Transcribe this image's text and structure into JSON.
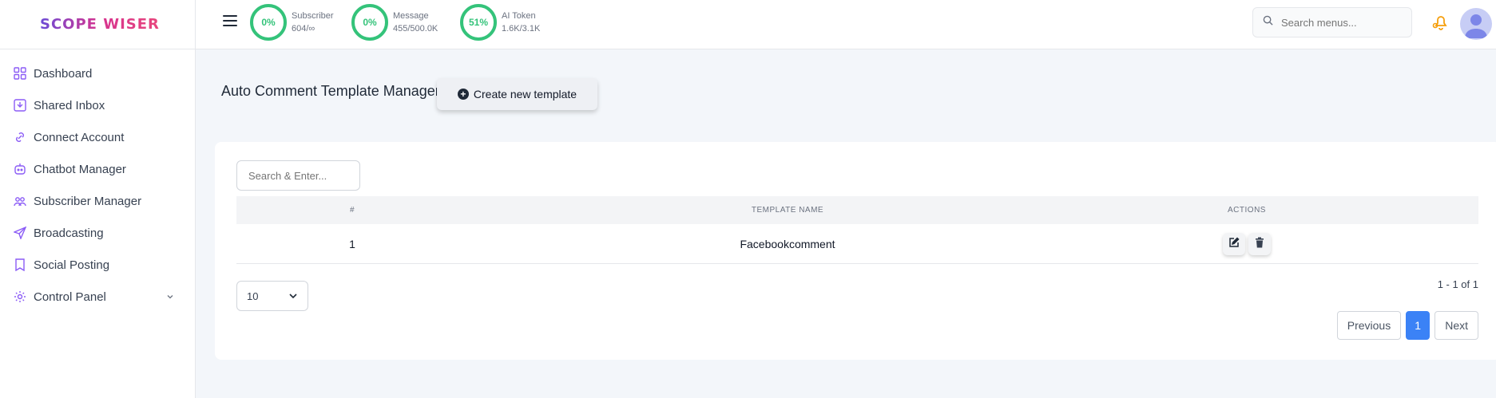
{
  "brand": {
    "logo_text": "SCOPE WISER"
  },
  "sidebar": {
    "items": [
      {
        "label": "Dashboard",
        "icon": "grid-icon"
      },
      {
        "label": "Shared Inbox",
        "icon": "inbox-icon"
      },
      {
        "label": "Connect Account",
        "icon": "link-icon"
      },
      {
        "label": "Chatbot Manager",
        "icon": "bot-icon"
      },
      {
        "label": "Subscriber Manager",
        "icon": "users-icon"
      },
      {
        "label": "Broadcasting",
        "icon": "send-icon"
      },
      {
        "label": "Social Posting",
        "icon": "bookmark-icon"
      },
      {
        "label": "Control Panel",
        "icon": "gear-icon"
      }
    ]
  },
  "stats": [
    {
      "percent": "0%",
      "label": "Subscriber",
      "value": "604/∞"
    },
    {
      "percent": "0%",
      "label": "Message",
      "value": "455/500.0K"
    },
    {
      "percent": "51%",
      "label": "AI Token",
      "value": "1.6K/3.1K"
    }
  ],
  "search_menus": {
    "placeholder": "Search menus..."
  },
  "page": {
    "title": "Auto Comment Template Manager",
    "create_button": "Create new template"
  },
  "table": {
    "search_placeholder": "Search & Enter...",
    "columns": [
      "#",
      "TEMPLATE NAME",
      "ACTIONS"
    ],
    "rows": [
      {
        "index": "1",
        "name": "Facebookcomment"
      }
    ],
    "page_size": "10",
    "range_text": "1 - 1 of 1",
    "pagination": {
      "previous": "Previous",
      "current": "1",
      "next": "Next"
    }
  },
  "colors": {
    "accent": "#34c37a",
    "primary": "#3b82f6",
    "bell": "#f59e0b"
  }
}
